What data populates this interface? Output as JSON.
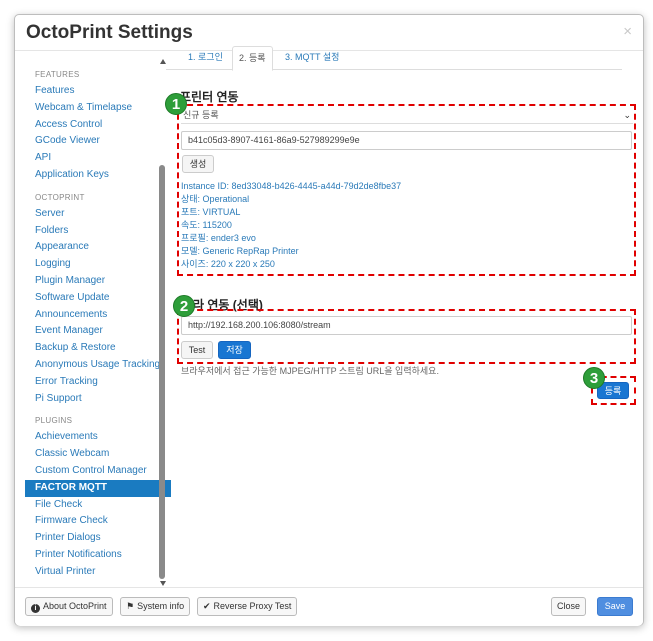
{
  "modal": {
    "title": "OctoPrint Settings",
    "close_glyph": "×"
  },
  "sidebar": {
    "sections": [
      {
        "heading": "FEATURES",
        "items": [
          "Features",
          "Webcam & Timelapse",
          "Access Control",
          "GCode Viewer",
          "API",
          "Application Keys"
        ]
      },
      {
        "heading": "OCTOPRINT",
        "items": [
          "Server",
          "Folders",
          "Appearance",
          "Logging",
          "Plugin Manager",
          "Software Update",
          "Announcements",
          "Event Manager",
          "Backup & Restore",
          "Anonymous Usage Tracking",
          "Error Tracking",
          "Pi Support"
        ]
      },
      {
        "heading": "PLUGINS",
        "items": [
          "Achievements",
          "Classic Webcam",
          "Custom Control Manager",
          "FACTOR MQTT",
          "File Check",
          "Firmware Check",
          "Printer Dialogs",
          "Printer Notifications",
          "Virtual Printer"
        ]
      }
    ],
    "active_item": "FACTOR MQTT"
  },
  "tabs": [
    "1. 로그인",
    "2. 등록",
    "3. MQTT 설정"
  ],
  "active_tab": "2. 등록",
  "printer": {
    "title": "프린터 연동",
    "select_value": "신규 등록",
    "instance_input": "b41c05d3-8907-4161-86a9-527989299e9e",
    "generate_button": "생성",
    "info": [
      "Instance ID: 8ed33048-b426-4445-a44d-79d2de8fbe37",
      "상태: Operational",
      "포트: VIRTUAL",
      "속도: 115200",
      "프로필: ender3 evo",
      "모델: Generic RepRap Printer",
      "사이즈: 220 x 220 x 250"
    ]
  },
  "camera": {
    "title": "라 연동 (선택)",
    "url_input": "http://192.168.200.106:8080/stream",
    "test_button": "Test",
    "save_button": "저장",
    "help": "브라우저에서 접근 가능한 MJPEG/HTTP 스트림 URL을 입력하세요."
  },
  "register_button": "등록",
  "badges": [
    "1",
    "2",
    "3"
  ],
  "footer": {
    "about": "About OctoPrint",
    "system_info": "System info",
    "reverse_proxy": "Reverse Proxy Test",
    "close": "Close",
    "save": "Save"
  },
  "colors": {
    "accent": "#1a7bc1",
    "link": "#2a7ab8",
    "annotation": "#e00000",
    "badge": "#2e9e3a"
  }
}
